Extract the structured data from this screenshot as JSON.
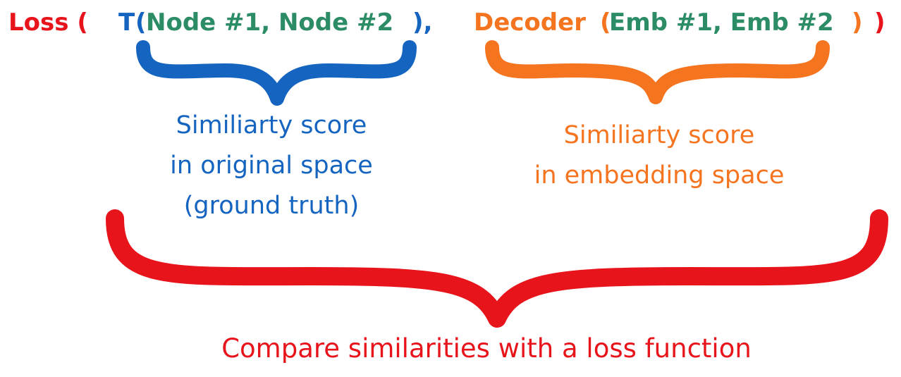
{
  "formula": {
    "loss_open": "Loss (",
    "t_func": "T",
    "t_open_paren": "(",
    "t_args": "Node #1, Node #2",
    "t_close_paren": "),",
    "decoder_func": "Decoder",
    "decoder_open_paren": "(",
    "decoder_args": "Emb #1, Emb #2",
    "decoder_close_paren": ")",
    "loss_close": ")"
  },
  "labels": {
    "original_line1": "Similiarty score",
    "original_line2": "in original space",
    "original_line3": "(ground truth)",
    "embedding_line1": "Similiarty score",
    "embedding_line2": "in embedding space",
    "compare": "Compare similarities with a loss function"
  },
  "colors": {
    "loss_red": "#e8141b",
    "t_blue": "#1565c0",
    "args_green": "#2b8c66",
    "decoder_orange": "#f57420"
  }
}
